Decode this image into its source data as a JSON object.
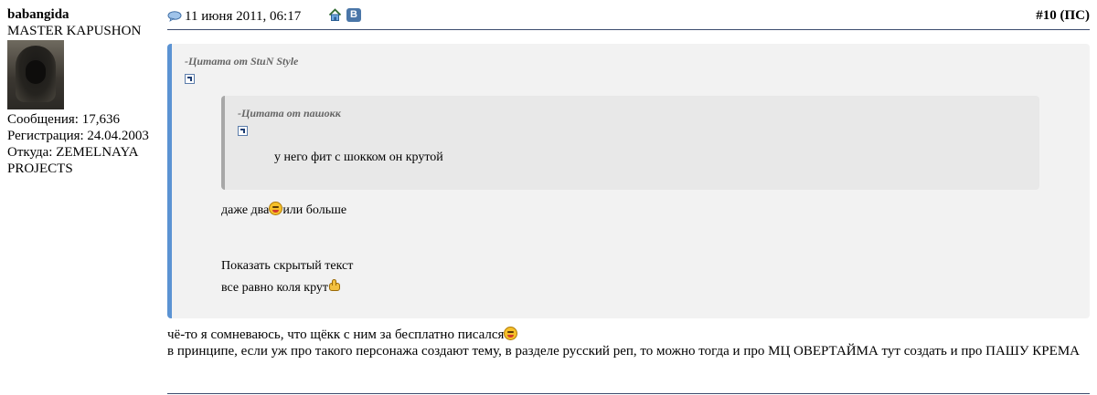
{
  "user": {
    "name": "babangida",
    "title": "MASTER KAPUSHON",
    "posts_label": "Сообщения: 17,636",
    "registered_label": "Регистрация: 24.04.2003",
    "location_label": "Откуда: ZEMELNAYA PROJECTS"
  },
  "post": {
    "date": "11 июня 2011, 06:17",
    "number_label": "#10",
    "ps_label": "(ПС)",
    "icons": {
      "post": "speech-bubble-icon",
      "home": "home-icon",
      "vk": "vk-share-icon",
      "vk_letter": "В"
    }
  },
  "outer_quote": {
    "author_line": "-Цитата от StuN Style",
    "inner_quote": {
      "author_line": "-Цитата от пашокк",
      "text": "у него фит с шокком он крутой"
    },
    "line1_before": "даже два",
    "line1_after": "или больше",
    "hidden_text_link": "Показать скрытый текст",
    "line2": "все равно коля крут"
  },
  "message": {
    "line1": "чё-то я сомневаюсь, что щёкк с ним за бесплатно писался",
    "line2": "в принципе, если уж про такого персонажа создают тему, в разделе русский реп, то можно тогда и про МЦ ОВЕРТАЙМА тут создать и про ПАШУ КРЕМА"
  },
  "colors": {
    "quote_border": "#5b93d3",
    "header_rule": "#3b4b6e",
    "quote_bg": "#f2f2f2"
  }
}
